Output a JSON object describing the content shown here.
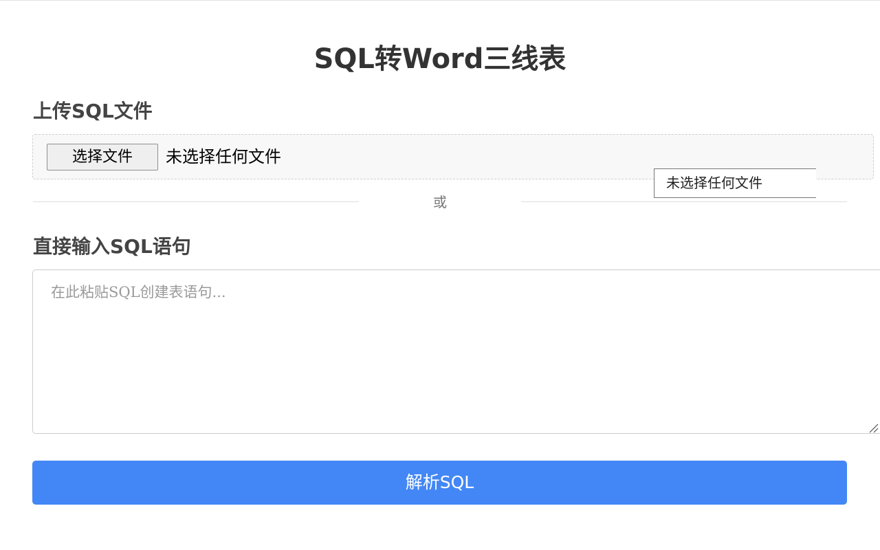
{
  "page": {
    "title": "SQL转Word三线表"
  },
  "upload": {
    "heading": "上传SQL文件",
    "button_label": "选择文件",
    "status": "未选择任何文件",
    "tooltip": "未选择任何文件"
  },
  "divider": {
    "text": "或"
  },
  "sql_input": {
    "heading": "直接输入SQL语句",
    "placeholder": "在此粘贴SQL创建表语句...",
    "value": ""
  },
  "actions": {
    "parse_label": "解析SQL"
  },
  "colors": {
    "primary": "#4287f5",
    "upload_background": "#f8f8f8"
  }
}
